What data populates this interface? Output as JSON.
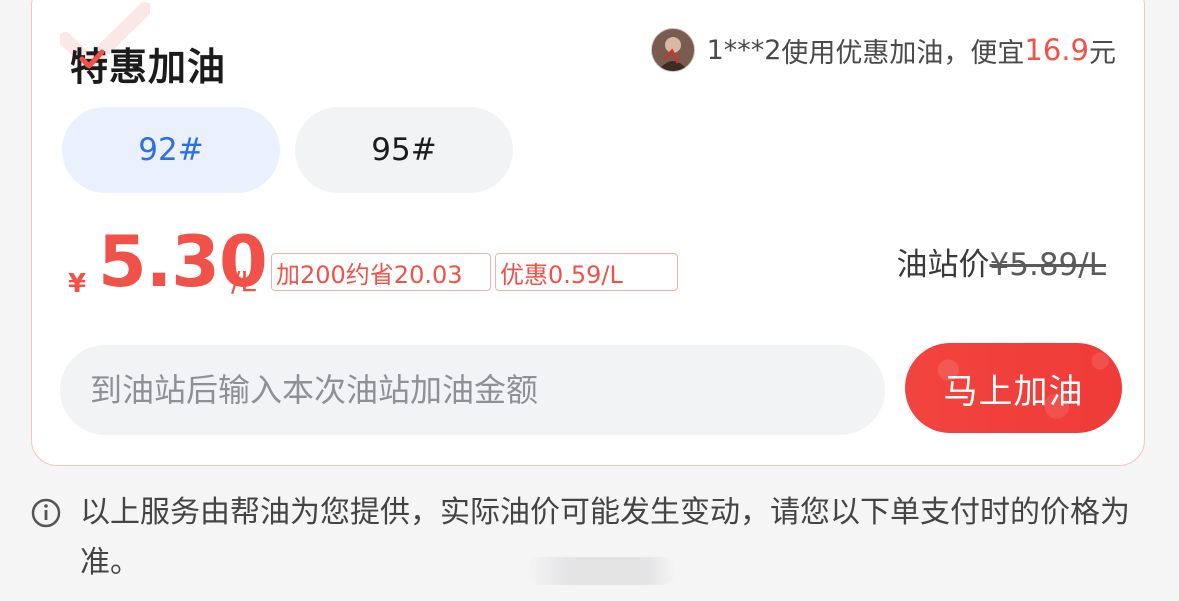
{
  "card": {
    "title": "特惠加油",
    "promo": {
      "user": "1***2",
      "text_before": "使用优惠加油，便宜",
      "amount": "16.9",
      "unit": "元"
    },
    "fuel_types": [
      {
        "label": "92#",
        "selected": true
      },
      {
        "label": "95#",
        "selected": false
      }
    ],
    "price": {
      "currency": "¥",
      "value": "5.30",
      "unit": "/L",
      "tag_savings": "加200约省20.03",
      "tag_discount": "优惠0.59/L"
    },
    "station_price": {
      "label": "油站价",
      "value": "¥5.89/L"
    },
    "amount_input": {
      "placeholder": "到油站后输入本次油站加油金额"
    },
    "refuel_button": "马上加油"
  },
  "notice": "以上服务由帮油为您提供，实际油价可能发生变动，请您以下单支付时的价格为准。",
  "colors": {
    "accent_red": "#f0524a",
    "selected_blue": "#2f6fe3",
    "selected_bg": "#eaf1fd",
    "button_red": "#f2403c"
  },
  "icons": [
    "user-avatar",
    "info-circle-icon",
    "check-mark-icon"
  ]
}
